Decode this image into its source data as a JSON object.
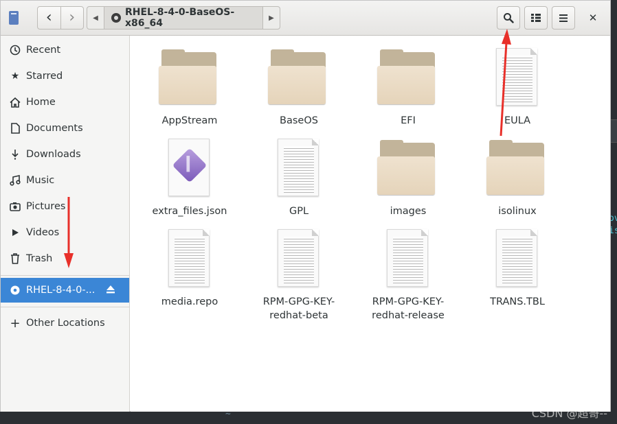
{
  "window": {
    "path": "RHEL-8-4-0-BaseOS-x86_64"
  },
  "toolbar": {
    "back": "‹",
    "forward": "›",
    "close": "✕"
  },
  "sidebar": {
    "items": [
      {
        "label": "Recent",
        "icon": "clock-icon"
      },
      {
        "label": "Starred",
        "icon": "star-icon"
      },
      {
        "label": "Home",
        "icon": "home-icon"
      },
      {
        "label": "Documents",
        "icon": "document-icon"
      },
      {
        "label": "Downloads",
        "icon": "download-icon"
      },
      {
        "label": "Music",
        "icon": "music-icon"
      },
      {
        "label": "Pictures",
        "icon": "camera-icon"
      },
      {
        "label": "Videos",
        "icon": "video-icon"
      },
      {
        "label": "Trash",
        "icon": "trash-icon"
      }
    ],
    "mounted": {
      "label": "RHEL-8-4-0-...",
      "icon": "disc-icon"
    },
    "other": {
      "label": "Other Locations",
      "icon": "plus-icon"
    }
  },
  "files": [
    {
      "name": "AppStream",
      "type": "folder"
    },
    {
      "name": "BaseOS",
      "type": "folder"
    },
    {
      "name": "EFI",
      "type": "folder"
    },
    {
      "name": "EULA",
      "type": "document"
    },
    {
      "name": "extra_files.json",
      "type": "json"
    },
    {
      "name": "GPL",
      "type": "document"
    },
    {
      "name": "images",
      "type": "folder"
    },
    {
      "name": "isolinux",
      "type": "folder"
    },
    {
      "name": "media.repo",
      "type": "document"
    },
    {
      "name": "RPM-GPG-KEY-redhat-beta",
      "type": "document"
    },
    {
      "name": "RPM-GPG-KEY-redhat-release",
      "type": "document"
    },
    {
      "name": "TRANS.TBL",
      "type": "document"
    }
  ],
  "background": {
    "terminal_text": "ov\nis",
    "tilde": "~",
    "watermark": "CSDN @超哥--"
  },
  "colors": {
    "accent": "#3b86d6",
    "annotation_arrow": "#e8302a"
  }
}
